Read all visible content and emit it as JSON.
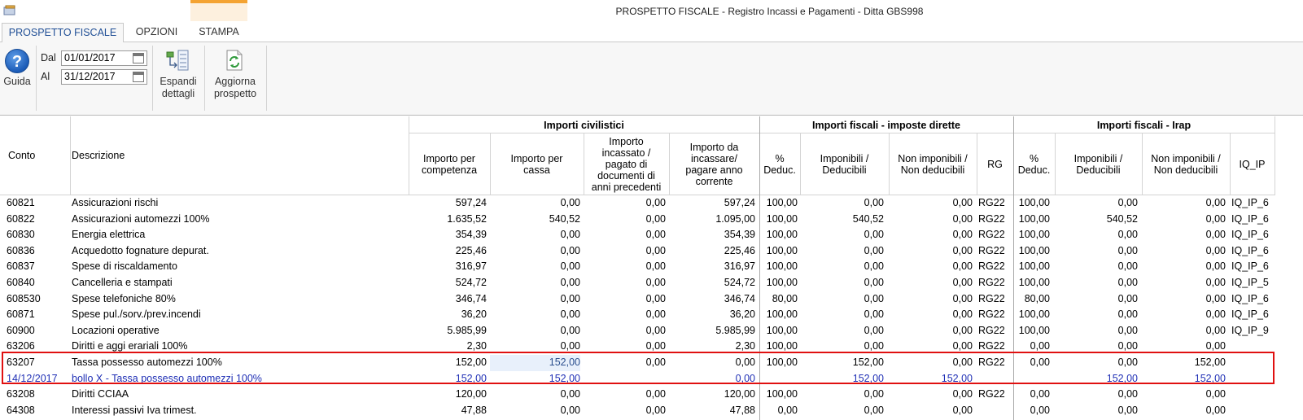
{
  "window": {
    "title": "PROSPETTO FISCALE - Registro Incassi e Pagamenti - Ditta GBS998"
  },
  "tabs": [
    {
      "label": "PROSPETTO FISCALE"
    },
    {
      "label": "OPZIONI"
    },
    {
      "label": "STAMPA"
    }
  ],
  "ribbon": {
    "help_label": "Guida",
    "from_label": "Dal",
    "from_value": "01/01/2017",
    "to_label": "Al",
    "to_value": "31/12/2017",
    "expand_label_1": "Espandi",
    "expand_label_2": "dettagli",
    "refresh_label_1": "Aggiorna",
    "refresh_label_2": "prospetto"
  },
  "table": {
    "group_headers": {
      "civilistici": "Importi civilistici",
      "fiscali_dirette": "Importi fiscali - imposte dirette",
      "fiscali_irap": "Importi fiscali - Irap"
    },
    "headers": {
      "conto": "Conto",
      "descrizione": "Descrizione",
      "competenza": "Importo per competenza",
      "cassa": "Importo per cassa",
      "incassato": "Importo incassato / pagato di documenti di anni precedenti",
      "da_incassare": "Importo da incassare/ pagare anno corrente",
      "perc_dir": "% Deduc.",
      "imponibili_dir": "Imponibili / Deducibili",
      "non_imponibili_dir": "Non imponibili / Non deducibili",
      "rg": "RG",
      "perc_irap": "% Deduc.",
      "imponibili_irap": "Imponibili / Deducibili",
      "non_imponibili_irap": "Non imponibili / Non deducibili",
      "iq": "IQ_IP"
    },
    "rows": [
      {
        "conto": "60821",
        "descrizione": "Assicurazioni rischi",
        "competenza": "597,24",
        "cassa": "0,00",
        "incassato": "0,00",
        "da_incassare": "597,24",
        "perc_dir": "100,00",
        "imponibili_dir": "0,00",
        "non_imponibili_dir": "0,00",
        "rg": "RG22",
        "perc_irap": "100,00",
        "imponibili_irap": "0,00",
        "non_imponibili_irap": "0,00",
        "iq": "IQ_IP_6"
      },
      {
        "conto": "60822",
        "descrizione": "Assicurazioni automezzi 100%",
        "competenza": "1.635,52",
        "cassa": "540,52",
        "incassato": "0,00",
        "da_incassare": "1.095,00",
        "perc_dir": "100,00",
        "imponibili_dir": "540,52",
        "non_imponibili_dir": "0,00",
        "rg": "RG22",
        "perc_irap": "100,00",
        "imponibili_irap": "540,52",
        "non_imponibili_irap": "0,00",
        "iq": "IQ_IP_6"
      },
      {
        "conto": "60830",
        "descrizione": "Energia elettrica",
        "competenza": "354,39",
        "cassa": "0,00",
        "incassato": "0,00",
        "da_incassare": "354,39",
        "perc_dir": "100,00",
        "imponibili_dir": "0,00",
        "non_imponibili_dir": "0,00",
        "rg": "RG22",
        "perc_irap": "100,00",
        "imponibili_irap": "0,00",
        "non_imponibili_irap": "0,00",
        "iq": "IQ_IP_6"
      },
      {
        "conto": "60836",
        "descrizione": "Acquedotto fognature depurat.",
        "competenza": "225,46",
        "cassa": "0,00",
        "incassato": "0,00",
        "da_incassare": "225,46",
        "perc_dir": "100,00",
        "imponibili_dir": "0,00",
        "non_imponibili_dir": "0,00",
        "rg": "RG22",
        "perc_irap": "100,00",
        "imponibili_irap": "0,00",
        "non_imponibili_irap": "0,00",
        "iq": "IQ_IP_6"
      },
      {
        "conto": "60837",
        "descrizione": "Spese di riscaldamento",
        "competenza": "316,97",
        "cassa": "0,00",
        "incassato": "0,00",
        "da_incassare": "316,97",
        "perc_dir": "100,00",
        "imponibili_dir": "0,00",
        "non_imponibili_dir": "0,00",
        "rg": "RG22",
        "perc_irap": "100,00",
        "imponibili_irap": "0,00",
        "non_imponibili_irap": "0,00",
        "iq": "IQ_IP_6"
      },
      {
        "conto": "60840",
        "descrizione": "Cancelleria e stampati",
        "competenza": "524,72",
        "cassa": "0,00",
        "incassato": "0,00",
        "da_incassare": "524,72",
        "perc_dir": "100,00",
        "imponibili_dir": "0,00",
        "non_imponibili_dir": "0,00",
        "rg": "RG22",
        "perc_irap": "100,00",
        "imponibili_irap": "0,00",
        "non_imponibili_irap": "0,00",
        "iq": "IQ_IP_5"
      },
      {
        "conto": "608530",
        "descrizione": "Spese telefoniche 80%",
        "competenza": "346,74",
        "cassa": "0,00",
        "incassato": "0,00",
        "da_incassare": "346,74",
        "perc_dir": "80,00",
        "imponibili_dir": "0,00",
        "non_imponibili_dir": "0,00",
        "rg": "RG22",
        "perc_irap": "80,00",
        "imponibili_irap": "0,00",
        "non_imponibili_irap": "0,00",
        "iq": "IQ_IP_6"
      },
      {
        "conto": "60871",
        "descrizione": "Spese pul./sorv./prev.incendi",
        "competenza": "36,20",
        "cassa": "0,00",
        "incassato": "0,00",
        "da_incassare": "36,20",
        "perc_dir": "100,00",
        "imponibili_dir": "0,00",
        "non_imponibili_dir": "0,00",
        "rg": "RG22",
        "perc_irap": "100,00",
        "imponibili_irap": "0,00",
        "non_imponibili_irap": "0,00",
        "iq": "IQ_IP_6"
      },
      {
        "conto": "60900",
        "descrizione": "Locazioni operative",
        "competenza": "5.985,99",
        "cassa": "0,00",
        "incassato": "0,00",
        "da_incassare": "5.985,99",
        "perc_dir": "100,00",
        "imponibili_dir": "0,00",
        "non_imponibili_dir": "0,00",
        "rg": "RG22",
        "perc_irap": "100,00",
        "imponibili_irap": "0,00",
        "non_imponibili_irap": "0,00",
        "iq": "IQ_IP_9"
      },
      {
        "conto": "63206",
        "descrizione": "Diritti e aggi erariali 100%",
        "competenza": "2,30",
        "cassa": "0,00",
        "incassato": "0,00",
        "da_incassare": "2,30",
        "perc_dir": "100,00",
        "imponibili_dir": "0,00",
        "non_imponibili_dir": "0,00",
        "rg": "RG22",
        "perc_irap": "0,00",
        "imponibili_irap": "0,00",
        "non_imponibili_irap": "0,00",
        "iq": ""
      },
      {
        "conto": "63207",
        "descrizione": "Tassa possesso automezzi 100%",
        "competenza": "152,00",
        "cassa": "152,00",
        "incassato": "0,00",
        "da_incassare": "0,00",
        "perc_dir": "100,00",
        "imponibili_dir": "152,00",
        "non_imponibili_dir": "0,00",
        "rg": "RG22",
        "perc_irap": "0,00",
        "imponibili_irap": "0,00",
        "non_imponibili_irap": "152,00",
        "iq": ""
      },
      {
        "conto": "14/12/2017",
        "descrizione": "bollo X -  Tassa possesso automezzi 100%",
        "competenza": "152,00",
        "cassa": "152,00",
        "incassato": "",
        "da_incassare": "0,00",
        "perc_dir": "",
        "imponibili_dir": "152,00",
        "non_imponibili_dir": "152,00",
        "rg": "",
        "perc_irap": "",
        "imponibili_irap": "152,00",
        "non_imponibili_irap": "152,00",
        "iq": ""
      },
      {
        "conto": "63208",
        "descrizione": "Diritti CCIAA",
        "competenza": "120,00",
        "cassa": "0,00",
        "incassato": "0,00",
        "da_incassare": "120,00",
        "perc_dir": "100,00",
        "imponibili_dir": "0,00",
        "non_imponibili_dir": "0,00",
        "rg": "RG22",
        "perc_irap": "0,00",
        "imponibili_irap": "0,00",
        "non_imponibili_irap": "0,00",
        "iq": ""
      },
      {
        "conto": "64308",
        "descrizione": "Interessi passivi Iva trimest.",
        "competenza": "47,88",
        "cassa": "0,00",
        "incassato": "0,00",
        "da_incassare": "47,88",
        "perc_dir": "0,00",
        "imponibili_dir": "0,00",
        "non_imponibili_dir": "0,00",
        "rg": "",
        "perc_irap": "0,00",
        "imponibili_irap": "0,00",
        "non_imponibili_irap": "0,00",
        "iq": ""
      }
    ]
  }
}
